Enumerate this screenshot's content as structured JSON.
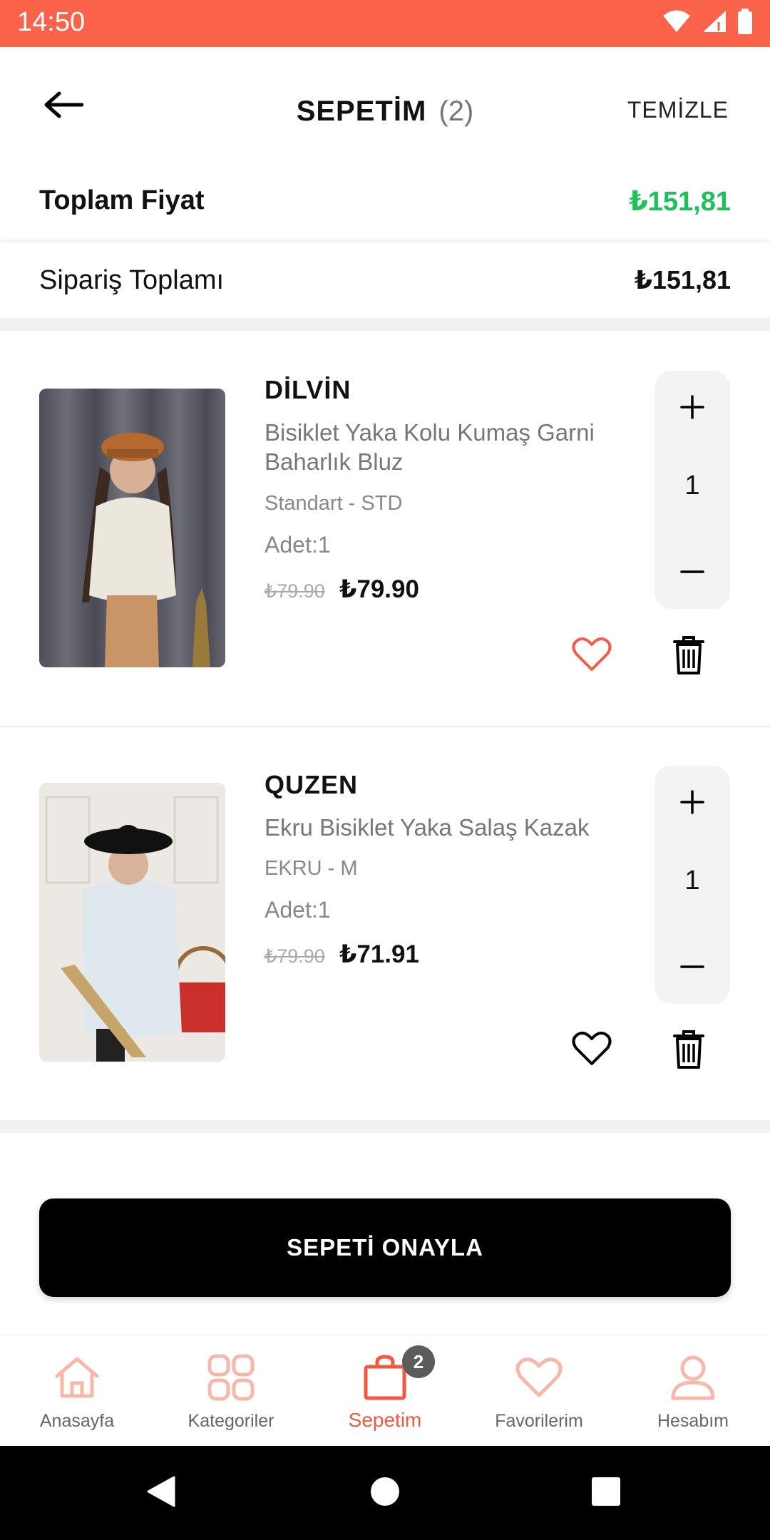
{
  "status_bar": {
    "time": "14:50",
    "background": "#fa634a",
    "icons": [
      "wifi-icon",
      "signal-icon",
      "battery-icon"
    ]
  },
  "header": {
    "title": "SEPETİM",
    "count": "(2)",
    "clear_label": "TEMİZLE",
    "back_icon": "arrow-left-icon"
  },
  "summary": {
    "total_label": "Toplam Fiyat",
    "total_value": "₺151,81",
    "total_color": "#1ec05a",
    "order_label": "Sipariş Toplamı",
    "order_value": "₺151,81"
  },
  "items": [
    {
      "brand": "DİLVİN",
      "name": "Bisiklet Yaka Kolu Kumaş Garni Baharlık Bluz",
      "variant": "Standart - STD",
      "qty_text": "Adet:1",
      "old_price": "₺79.90",
      "new_price": "₺79.90",
      "quantity": "1",
      "favorited": true
    },
    {
      "brand": "QUZEN",
      "name": "Ekru Bisiklet Yaka Salaş Kazak",
      "variant": "EKRU - M",
      "qty_text": "Adet:1",
      "old_price": "₺79.90",
      "new_price": "₺71.91",
      "quantity": "1",
      "favorited": false
    }
  ],
  "confirm_label": "SEPETİ ONAYLA",
  "bottom_nav": {
    "items": [
      {
        "label": "Anasayfa",
        "icon": "home-icon"
      },
      {
        "label": "Kategoriler",
        "icon": "grid-icon"
      },
      {
        "label": "Sepetim",
        "icon": "shopping-bag-icon",
        "active": true
      },
      {
        "label": "Favorilerim",
        "icon": "heart-icon"
      },
      {
        "label": "Hesabım",
        "icon": "user-icon"
      }
    ],
    "cart_badge": "2",
    "accent": "#f25a3f"
  },
  "system_nav": [
    "back-triangle-icon",
    "home-circle-icon",
    "recents-square-icon"
  ]
}
